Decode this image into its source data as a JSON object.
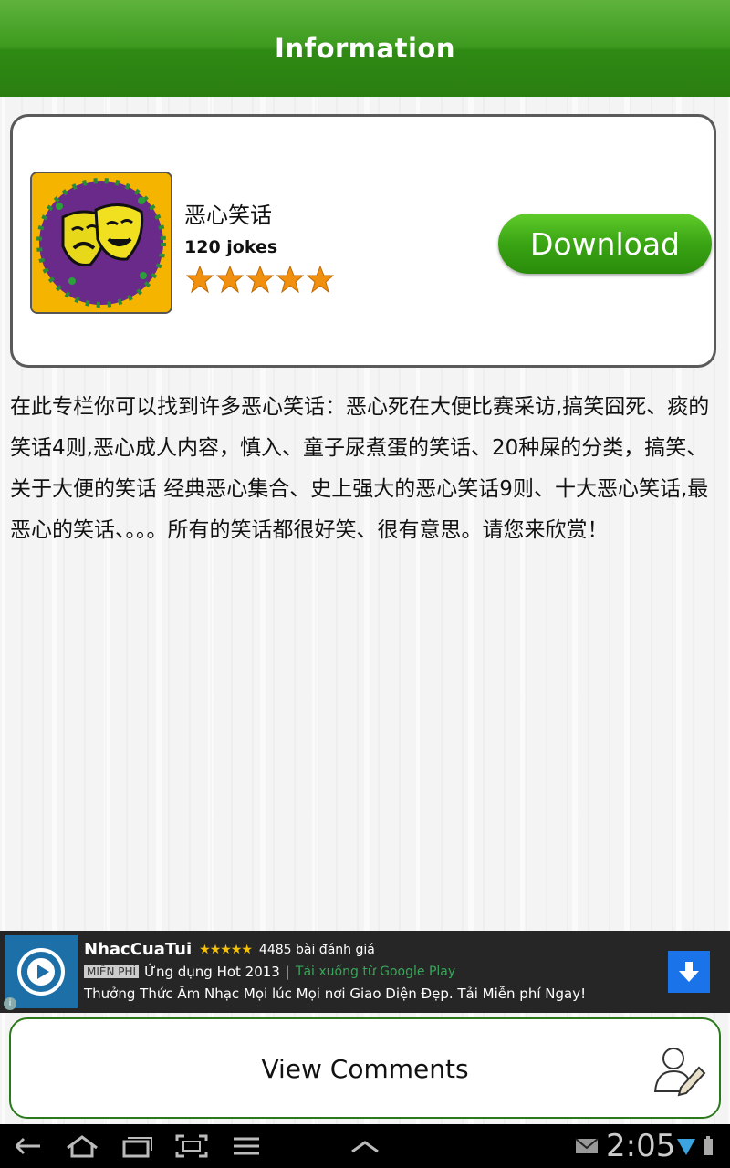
{
  "header": {
    "title": "Information"
  },
  "app": {
    "name": "恶心笑话",
    "count": "120 jokes",
    "rating_stars": 5,
    "download_label": "Download"
  },
  "description": "在此专栏你可以找到许多恶心笑话：恶心死在大便比赛采访,搞笑囧死、痰的笑话4则,恶心成人内容，慎入、童子尿煮蛋的笑话、20种屎的分类，搞笑、关于大便的笑话 经典恶心集合、史上强大的恶心笑话9则、十大恶心笑话,最恶心的笑话、。。。所有的笑话都很好笑、很有意思。请您来欣赏！",
  "ad": {
    "app_name": "NhacCuaTui",
    "stars": "★★★★★",
    "rating": "4485 bài đánh giá",
    "badge": "MIỄN PHÍ",
    "tagline": "Ứng dụng Hot 2013",
    "separator": "|",
    "store_text": "Tải xuống từ Google Play",
    "body": "Thưởng Thức Âm Nhạc Mọi lúc Mọi nơi Giao Diện Đẹp. Tải Miễn phí Ngay!",
    "info": "i"
  },
  "comments": {
    "label": "View Comments"
  },
  "statusbar": {
    "time": "2:05"
  },
  "icons": {
    "back": "back-icon",
    "home": "home-icon",
    "recents": "recents-icon",
    "screenshot": "screenshot-icon",
    "menu": "menu-icon",
    "up": "chevron-up-icon",
    "gmail": "gmail-icon",
    "wifi": "wifi-icon",
    "battery": "battery-icon"
  },
  "colors": {
    "header_green": "#3d9a1f",
    "button_green": "#3aa414",
    "star": "#f0900e"
  }
}
